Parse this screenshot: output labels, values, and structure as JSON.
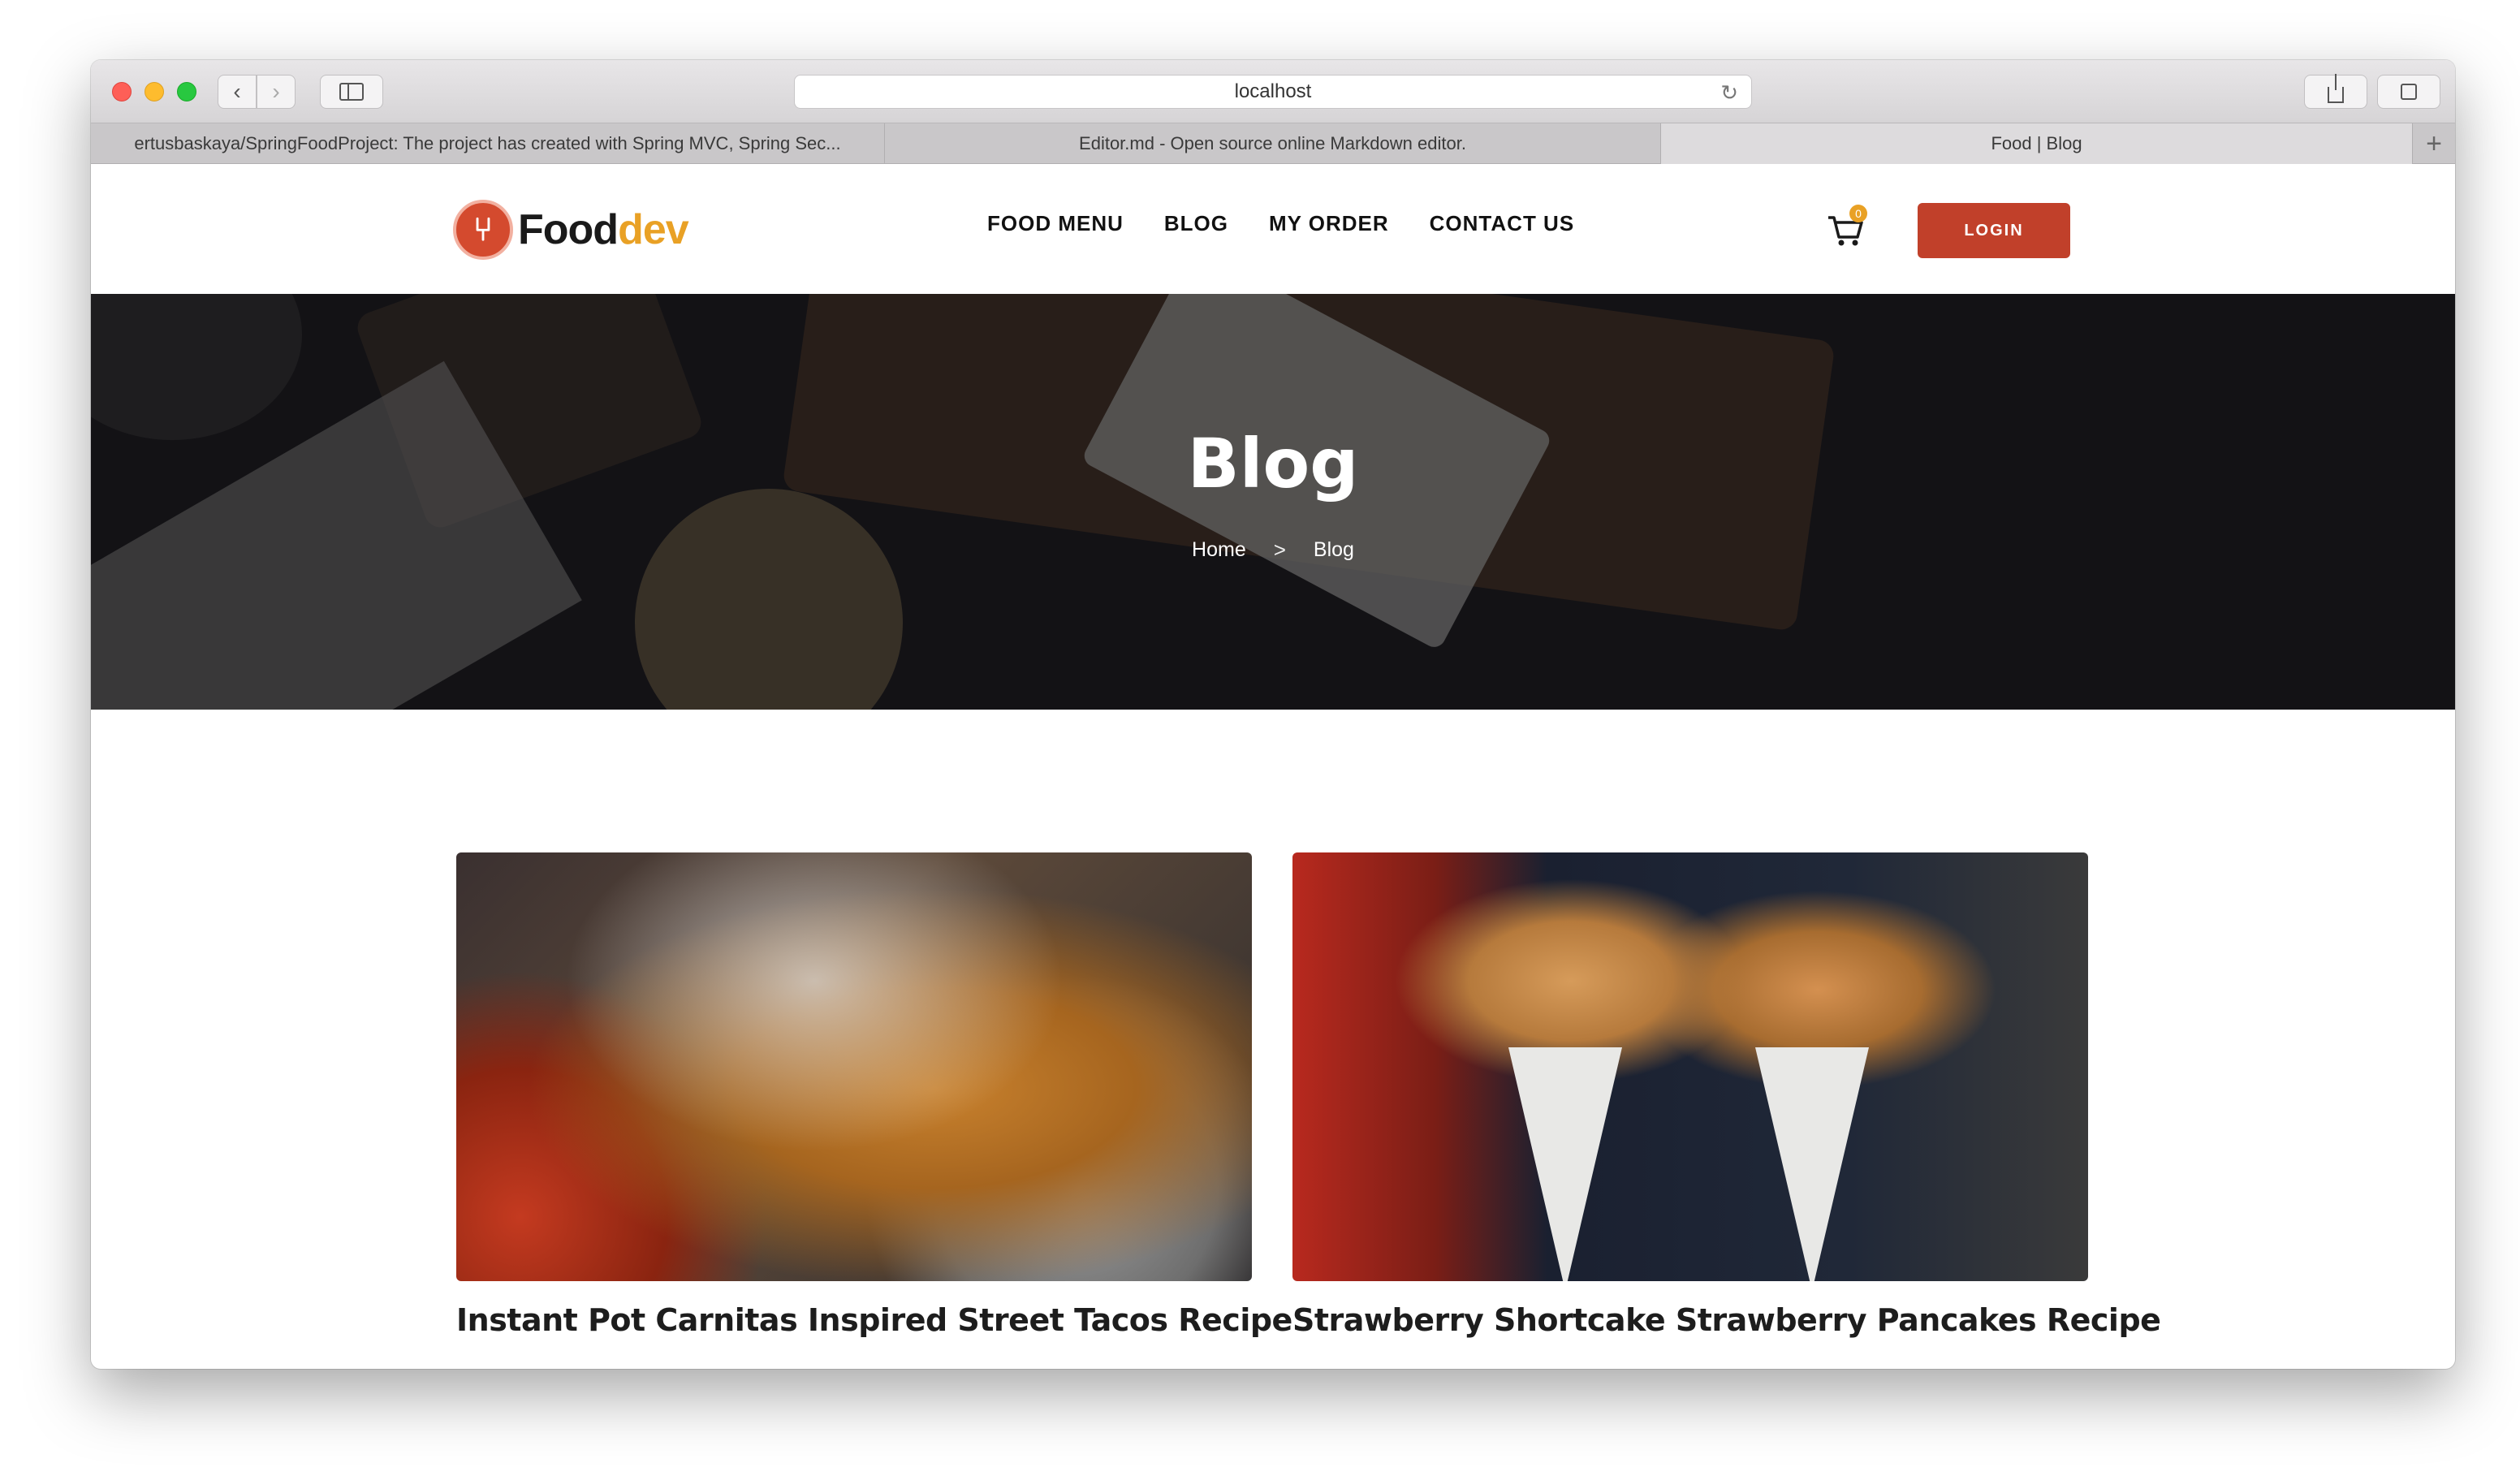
{
  "browser": {
    "url": "localhost",
    "tabs": [
      {
        "label": "ertusbaskaya/SpringFoodProject: The project has created with Spring MVC, Spring Sec..."
      },
      {
        "label": "Editor.md - Open source online Markdown editor."
      },
      {
        "label": "Food | Blog"
      }
    ],
    "new_tab_label": "+"
  },
  "site": {
    "logo_food": "Food",
    "logo_dev": "dev",
    "nav": [
      {
        "label": "FOOD MENU"
      },
      {
        "label": "BLOG"
      },
      {
        "label": "MY ORDER"
      },
      {
        "label": "CONTACT US"
      }
    ],
    "cart_count": "0",
    "login_label": "LOGIN"
  },
  "hero": {
    "title": "Blog",
    "breadcrumb": {
      "home": "Home",
      "separator": ">",
      "current": "Blog"
    }
  },
  "posts": [
    {
      "title": "Instant Pot Carnitas Inspired Street Tacos Recipe",
      "image": "street-food-photo"
    },
    {
      "title": "Strawberry Shortcake Strawberry Pancakes Recipe",
      "image": "waffle-cones-photo"
    }
  ],
  "colors": {
    "accent_red": "#c1402a",
    "accent_orange": "#e9a125"
  }
}
